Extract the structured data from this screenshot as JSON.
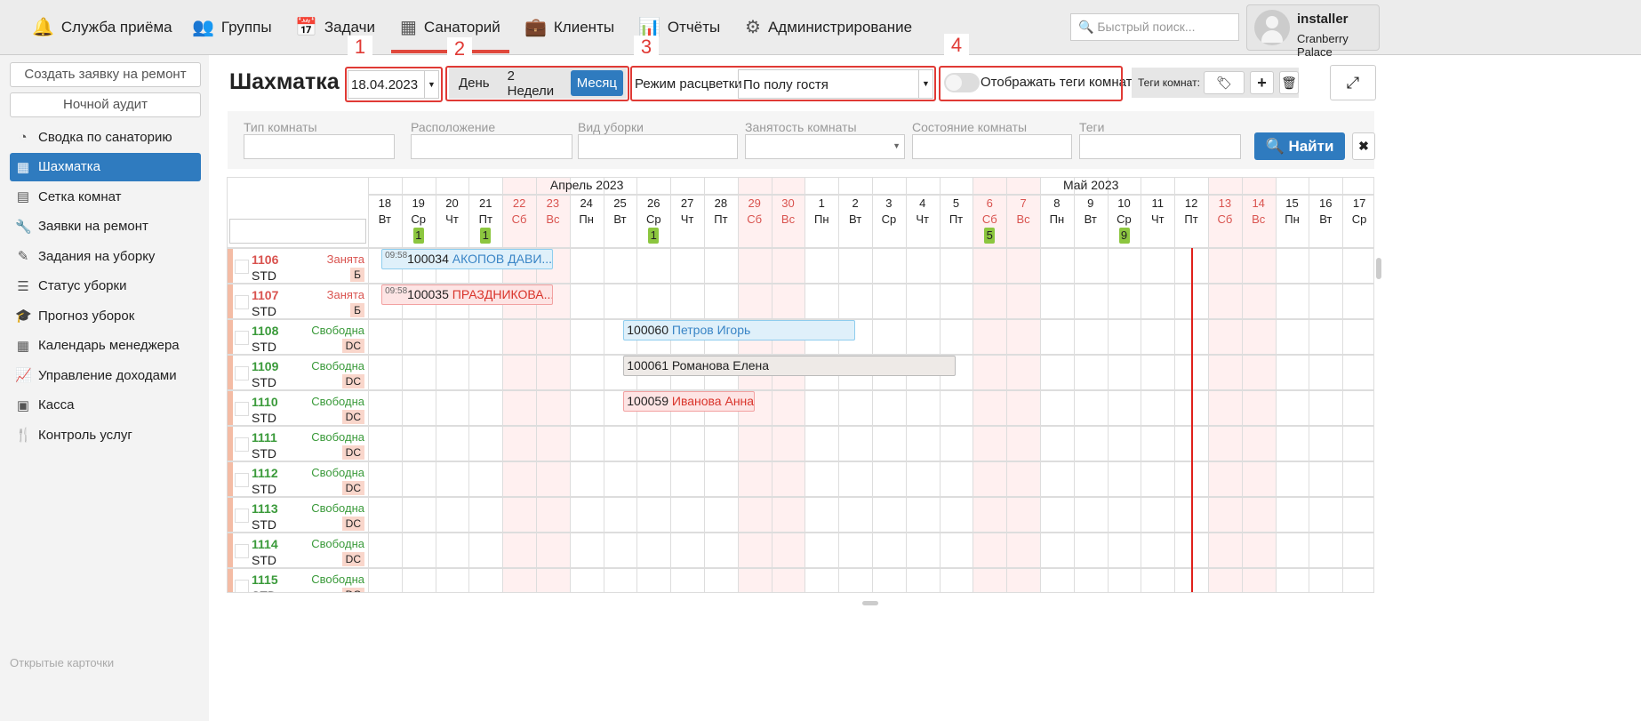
{
  "nav": [
    {
      "label": "Служба приёма",
      "icon": "bell-icon",
      "glyph": "🔔"
    },
    {
      "label": "Группы",
      "icon": "users-icon",
      "glyph": "👥"
    },
    {
      "label": "Задачи",
      "icon": "calendar-check-icon",
      "glyph": "📅"
    },
    {
      "label": "Санаторий",
      "icon": "building-icon",
      "glyph": "▦",
      "active": true
    },
    {
      "label": "Клиенты",
      "icon": "briefcase-icon",
      "glyph": "💼"
    },
    {
      "label": "Отчёты",
      "icon": "bar-chart-icon",
      "glyph": "📊"
    },
    {
      "label": "Администрирование",
      "icon": "gears-icon",
      "glyph": "⚙"
    }
  ],
  "search": {
    "placeholder": "Быстрый поиск..."
  },
  "user": {
    "name": "installer",
    "hotel": "Cranberry Palace"
  },
  "sidebar": {
    "create_repair": "Создать заявку на ремонт",
    "night_audit": "Ночной аудит",
    "items": [
      {
        "label": "Сводка по санаторию",
        "glyph": "◔"
      },
      {
        "label": "Шахматка",
        "glyph": "▦",
        "active": true
      },
      {
        "label": "Сетка комнат",
        "glyph": "▤"
      },
      {
        "label": "Заявки на ремонт",
        "glyph": "🔧"
      },
      {
        "label": "Задания на уборку",
        "glyph": "✎"
      },
      {
        "label": "Статус уборки",
        "glyph": "☰"
      },
      {
        "label": "Прогноз уборок",
        "glyph": "🎓"
      },
      {
        "label": "Календарь менеджера",
        "glyph": "▦"
      },
      {
        "label": "Управление доходами",
        "glyph": "📈"
      },
      {
        "label": "Касса",
        "glyph": "▣"
      },
      {
        "label": "Контроль услуг",
        "glyph": "🍴"
      }
    ],
    "open_cards": "Открытые карточки"
  },
  "page": {
    "title": "Шахматка",
    "date": "18.04.2023",
    "views": [
      "День",
      "2 Недели",
      "Месяц"
    ],
    "active_view": "Месяц",
    "color_mode_label": "Режим расцветки",
    "color_mode": "По полу гостя",
    "show_tags_label": "Отображать теги комнат",
    "room_tags_label": "Теги комнат:",
    "annotations": [
      "1",
      "2",
      "3",
      "4"
    ]
  },
  "filters": {
    "labels": [
      "Тип комнаты",
      "Расположение",
      "Вид уборки",
      "Занятость комнаты",
      "Состояние комнаты",
      "Теги"
    ],
    "find": "Найти"
  },
  "calendar": {
    "months": [
      {
        "label": "Апрель 2023",
        "days": 13
      },
      {
        "label": "Май 2023",
        "days": 17
      }
    ],
    "days": [
      [
        "18",
        "Вт"
      ],
      [
        "19",
        "Ср"
      ],
      [
        "20",
        "Чт"
      ],
      [
        "21",
        "Пт"
      ],
      [
        "22",
        "Сб"
      ],
      [
        "23",
        "Вс"
      ],
      [
        "24",
        "Пн"
      ],
      [
        "25",
        "Вт"
      ],
      [
        "26",
        "Ср"
      ],
      [
        "27",
        "Чт"
      ],
      [
        "28",
        "Пт"
      ],
      [
        "29",
        "Сб"
      ],
      [
        "30",
        "Вс"
      ],
      [
        "1",
        "Пн"
      ],
      [
        "2",
        "Вт"
      ],
      [
        "3",
        "Ср"
      ],
      [
        "4",
        "Чт"
      ],
      [
        "5",
        "Пт"
      ],
      [
        "6",
        "Сб"
      ],
      [
        "7",
        "Вс"
      ],
      [
        "8",
        "Пн"
      ],
      [
        "9",
        "Вт"
      ],
      [
        "10",
        "Ср"
      ],
      [
        "11",
        "Чт"
      ],
      [
        "12",
        "Пт"
      ],
      [
        "13",
        "Сб"
      ],
      [
        "14",
        "Вс"
      ],
      [
        "15",
        "Пн"
      ],
      [
        "16",
        "Вт"
      ],
      [
        "17",
        "Ср"
      ]
    ],
    "counts": {
      "1": "1",
      "3": "1",
      "8": "1",
      "18": "5",
      "22": "9"
    },
    "today_index": 24.5,
    "rooms": [
      {
        "number": "1106",
        "type": "STD",
        "status": "Занята",
        "badge": "Б",
        "occupied": true
      },
      {
        "number": "1107",
        "type": "STD",
        "status": "Занята",
        "badge": "Б",
        "occupied": true
      },
      {
        "number": "1108",
        "type": "STD",
        "status": "Свободна",
        "badge": "DC"
      },
      {
        "number": "1109",
        "type": "STD",
        "status": "Свободна",
        "badge": "DC"
      },
      {
        "number": "1110",
        "type": "STD",
        "status": "Свободна",
        "badge": "DC"
      },
      {
        "number": "1111",
        "type": "STD",
        "status": "Свободна",
        "badge": "DC"
      },
      {
        "number": "1112",
        "type": "STD",
        "status": "Свободна",
        "badge": "DC"
      },
      {
        "number": "1113",
        "type": "STD",
        "status": "Свободна",
        "badge": "DC"
      },
      {
        "number": "1114",
        "type": "STD",
        "status": "Свободна",
        "badge": "DC"
      },
      {
        "number": "1115",
        "type": "STD",
        "status": "Свободна",
        "badge": "DC"
      }
    ],
    "bookings": [
      {
        "row": 0,
        "start": 0.4,
        "end": 5.5,
        "time": "09:58",
        "id": "100034",
        "guest": "АКОПОВ ДАВИ...",
        "color": "#3a85c6",
        "bg": "#dff0fa",
        "border": "#8fcdee"
      },
      {
        "row": 1,
        "start": 0.4,
        "end": 5.5,
        "time": "09:58",
        "id": "100035",
        "guest": "ПРАЗДНИКОВА...",
        "color": "#d9342b",
        "bg": "#fde4e4",
        "border": "#f2a1a1"
      },
      {
        "row": 2,
        "start": 7.6,
        "end": 14.5,
        "id": "100060",
        "guest": "Петров Игорь",
        "color": "#3a85c6",
        "bg": "#dff0fa",
        "border": "#8fcdee"
      },
      {
        "row": 3,
        "start": 7.6,
        "end": 17.5,
        "id": "100061",
        "guest": "Романова Елена",
        "color": "#222",
        "bg": "#eeeae7",
        "border": "#bbb"
      },
      {
        "row": 4,
        "start": 7.6,
        "end": 11.5,
        "id": "100059",
        "guest": "Иванова Анна",
        "color": "#d9342b",
        "bg": "#fde4e4",
        "border": "#f2a1a1"
      }
    ]
  }
}
